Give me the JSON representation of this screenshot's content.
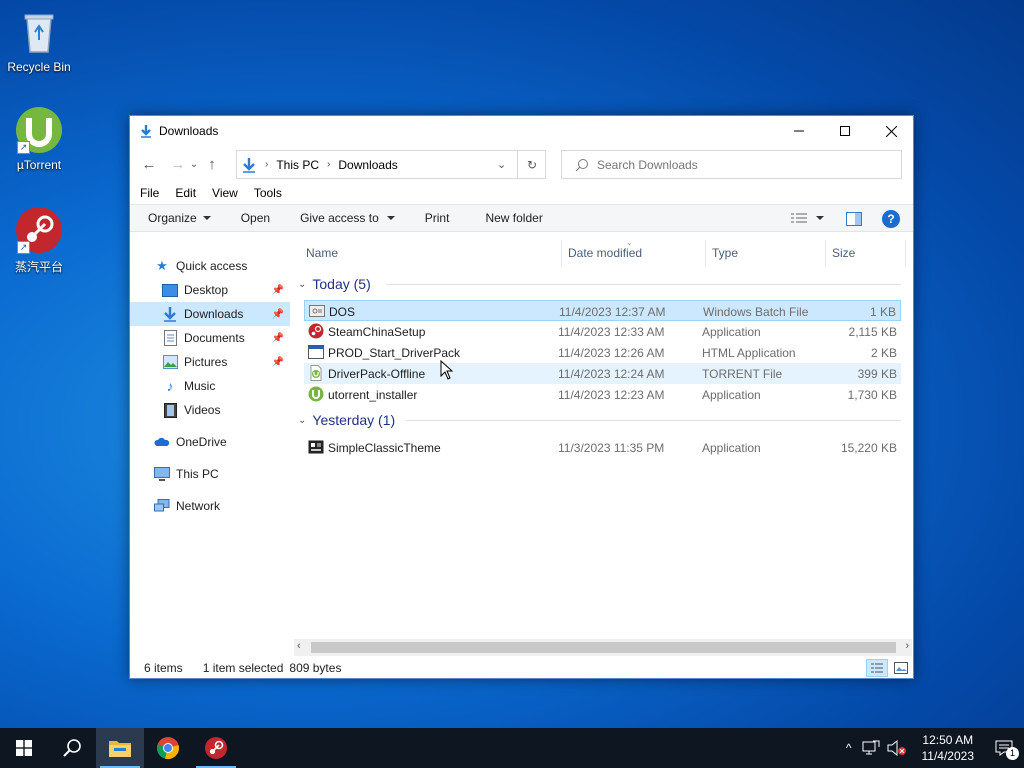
{
  "desktop": {
    "icons": [
      {
        "label": "Recycle Bin"
      },
      {
        "label": "µTorrent"
      },
      {
        "label": "蒸汽平台"
      }
    ]
  },
  "window": {
    "title": "Downloads",
    "address": {
      "crumbs": [
        "This PC",
        "Downloads"
      ]
    },
    "search_placeholder": "Search Downloads",
    "menu": [
      "File",
      "Edit",
      "View",
      "Tools"
    ],
    "commands": {
      "organize": "Organize",
      "open": "Open",
      "give_access": "Give access to",
      "print": "Print",
      "new_folder": "New folder"
    },
    "nav": {
      "quick_access": "Quick access",
      "desktop": "Desktop",
      "downloads": "Downloads",
      "documents": "Documents",
      "pictures": "Pictures",
      "music": "Music",
      "videos": "Videos",
      "onedrive": "OneDrive",
      "this_pc": "This PC",
      "network": "Network"
    },
    "columns": {
      "name": "Name",
      "date": "Date modified",
      "type": "Type",
      "size": "Size"
    },
    "groups": {
      "today": {
        "label": "Today (5)",
        "files": [
          {
            "name": "DOS",
            "date": "11/4/2023 12:37 AM",
            "type": "Windows Batch File",
            "size": "1 KB"
          },
          {
            "name": "SteamChinaSetup",
            "date": "11/4/2023 12:33 AM",
            "type": "Application",
            "size": "2,115 KB"
          },
          {
            "name": "PROD_Start_DriverPack",
            "date": "11/4/2023 12:26 AM",
            "type": "HTML Application",
            "size": "2 KB"
          },
          {
            "name": "DriverPack-Offline",
            "date": "11/4/2023 12:24 AM",
            "type": "TORRENT File",
            "size": "399 KB"
          },
          {
            "name": "utorrent_installer",
            "date": "11/4/2023 12:23 AM",
            "type": "Application",
            "size": "1,730 KB"
          }
        ]
      },
      "yesterday": {
        "label": "Yesterday (1)",
        "files": [
          {
            "name": "SimpleClassicTheme",
            "date": "11/3/2023 11:35 PM",
            "type": "Application",
            "size": "15,220 KB"
          }
        ]
      }
    },
    "status": {
      "count": "6 items",
      "selected": "1 item selected",
      "bytes": "809 bytes"
    }
  },
  "taskbar": {
    "time": "12:50 AM",
    "date": "11/4/2023",
    "notification_count": "1"
  },
  "colors": {
    "accent": "#0078d7",
    "selection": "#cce8ff",
    "taskbar": "#0e1621"
  }
}
